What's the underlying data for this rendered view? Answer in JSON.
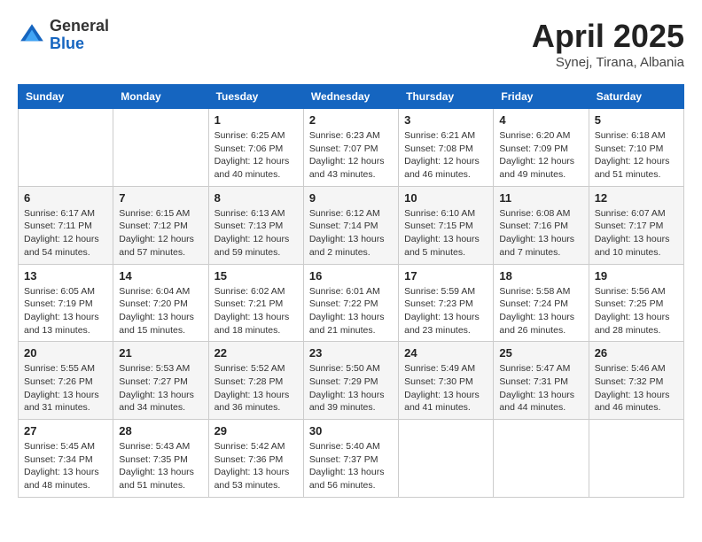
{
  "logo": {
    "general": "General",
    "blue": "Blue"
  },
  "title": "April 2025",
  "subtitle": "Synej, Tirana, Albania",
  "days_of_week": [
    "Sunday",
    "Monday",
    "Tuesday",
    "Wednesday",
    "Thursday",
    "Friday",
    "Saturday"
  ],
  "weeks": [
    [
      {
        "day": "",
        "info": ""
      },
      {
        "day": "",
        "info": ""
      },
      {
        "day": "1",
        "sunrise": "Sunrise: 6:25 AM",
        "sunset": "Sunset: 7:06 PM",
        "daylight": "Daylight: 12 hours and 40 minutes."
      },
      {
        "day": "2",
        "sunrise": "Sunrise: 6:23 AM",
        "sunset": "Sunset: 7:07 PM",
        "daylight": "Daylight: 12 hours and 43 minutes."
      },
      {
        "day": "3",
        "sunrise": "Sunrise: 6:21 AM",
        "sunset": "Sunset: 7:08 PM",
        "daylight": "Daylight: 12 hours and 46 minutes."
      },
      {
        "day": "4",
        "sunrise": "Sunrise: 6:20 AM",
        "sunset": "Sunset: 7:09 PM",
        "daylight": "Daylight: 12 hours and 49 minutes."
      },
      {
        "day": "5",
        "sunrise": "Sunrise: 6:18 AM",
        "sunset": "Sunset: 7:10 PM",
        "daylight": "Daylight: 12 hours and 51 minutes."
      }
    ],
    [
      {
        "day": "6",
        "sunrise": "Sunrise: 6:17 AM",
        "sunset": "Sunset: 7:11 PM",
        "daylight": "Daylight: 12 hours and 54 minutes."
      },
      {
        "day": "7",
        "sunrise": "Sunrise: 6:15 AM",
        "sunset": "Sunset: 7:12 PM",
        "daylight": "Daylight: 12 hours and 57 minutes."
      },
      {
        "day": "8",
        "sunrise": "Sunrise: 6:13 AM",
        "sunset": "Sunset: 7:13 PM",
        "daylight": "Daylight: 12 hours and 59 minutes."
      },
      {
        "day": "9",
        "sunrise": "Sunrise: 6:12 AM",
        "sunset": "Sunset: 7:14 PM",
        "daylight": "Daylight: 13 hours and 2 minutes."
      },
      {
        "day": "10",
        "sunrise": "Sunrise: 6:10 AM",
        "sunset": "Sunset: 7:15 PM",
        "daylight": "Daylight: 13 hours and 5 minutes."
      },
      {
        "day": "11",
        "sunrise": "Sunrise: 6:08 AM",
        "sunset": "Sunset: 7:16 PM",
        "daylight": "Daylight: 13 hours and 7 minutes."
      },
      {
        "day": "12",
        "sunrise": "Sunrise: 6:07 AM",
        "sunset": "Sunset: 7:17 PM",
        "daylight": "Daylight: 13 hours and 10 minutes."
      }
    ],
    [
      {
        "day": "13",
        "sunrise": "Sunrise: 6:05 AM",
        "sunset": "Sunset: 7:19 PM",
        "daylight": "Daylight: 13 hours and 13 minutes."
      },
      {
        "day": "14",
        "sunrise": "Sunrise: 6:04 AM",
        "sunset": "Sunset: 7:20 PM",
        "daylight": "Daylight: 13 hours and 15 minutes."
      },
      {
        "day": "15",
        "sunrise": "Sunrise: 6:02 AM",
        "sunset": "Sunset: 7:21 PM",
        "daylight": "Daylight: 13 hours and 18 minutes."
      },
      {
        "day": "16",
        "sunrise": "Sunrise: 6:01 AM",
        "sunset": "Sunset: 7:22 PM",
        "daylight": "Daylight: 13 hours and 21 minutes."
      },
      {
        "day": "17",
        "sunrise": "Sunrise: 5:59 AM",
        "sunset": "Sunset: 7:23 PM",
        "daylight": "Daylight: 13 hours and 23 minutes."
      },
      {
        "day": "18",
        "sunrise": "Sunrise: 5:58 AM",
        "sunset": "Sunset: 7:24 PM",
        "daylight": "Daylight: 13 hours and 26 minutes."
      },
      {
        "day": "19",
        "sunrise": "Sunrise: 5:56 AM",
        "sunset": "Sunset: 7:25 PM",
        "daylight": "Daylight: 13 hours and 28 minutes."
      }
    ],
    [
      {
        "day": "20",
        "sunrise": "Sunrise: 5:55 AM",
        "sunset": "Sunset: 7:26 PM",
        "daylight": "Daylight: 13 hours and 31 minutes."
      },
      {
        "day": "21",
        "sunrise": "Sunrise: 5:53 AM",
        "sunset": "Sunset: 7:27 PM",
        "daylight": "Daylight: 13 hours and 34 minutes."
      },
      {
        "day": "22",
        "sunrise": "Sunrise: 5:52 AM",
        "sunset": "Sunset: 7:28 PM",
        "daylight": "Daylight: 13 hours and 36 minutes."
      },
      {
        "day": "23",
        "sunrise": "Sunrise: 5:50 AM",
        "sunset": "Sunset: 7:29 PM",
        "daylight": "Daylight: 13 hours and 39 minutes."
      },
      {
        "day": "24",
        "sunrise": "Sunrise: 5:49 AM",
        "sunset": "Sunset: 7:30 PM",
        "daylight": "Daylight: 13 hours and 41 minutes."
      },
      {
        "day": "25",
        "sunrise": "Sunrise: 5:47 AM",
        "sunset": "Sunset: 7:31 PM",
        "daylight": "Daylight: 13 hours and 44 minutes."
      },
      {
        "day": "26",
        "sunrise": "Sunrise: 5:46 AM",
        "sunset": "Sunset: 7:32 PM",
        "daylight": "Daylight: 13 hours and 46 minutes."
      }
    ],
    [
      {
        "day": "27",
        "sunrise": "Sunrise: 5:45 AM",
        "sunset": "Sunset: 7:34 PM",
        "daylight": "Daylight: 13 hours and 48 minutes."
      },
      {
        "day": "28",
        "sunrise": "Sunrise: 5:43 AM",
        "sunset": "Sunset: 7:35 PM",
        "daylight": "Daylight: 13 hours and 51 minutes."
      },
      {
        "day": "29",
        "sunrise": "Sunrise: 5:42 AM",
        "sunset": "Sunset: 7:36 PM",
        "daylight": "Daylight: 13 hours and 53 minutes."
      },
      {
        "day": "30",
        "sunrise": "Sunrise: 5:40 AM",
        "sunset": "Sunset: 7:37 PM",
        "daylight": "Daylight: 13 hours and 56 minutes."
      },
      {
        "day": "",
        "info": ""
      },
      {
        "day": "",
        "info": ""
      },
      {
        "day": "",
        "info": ""
      }
    ]
  ]
}
